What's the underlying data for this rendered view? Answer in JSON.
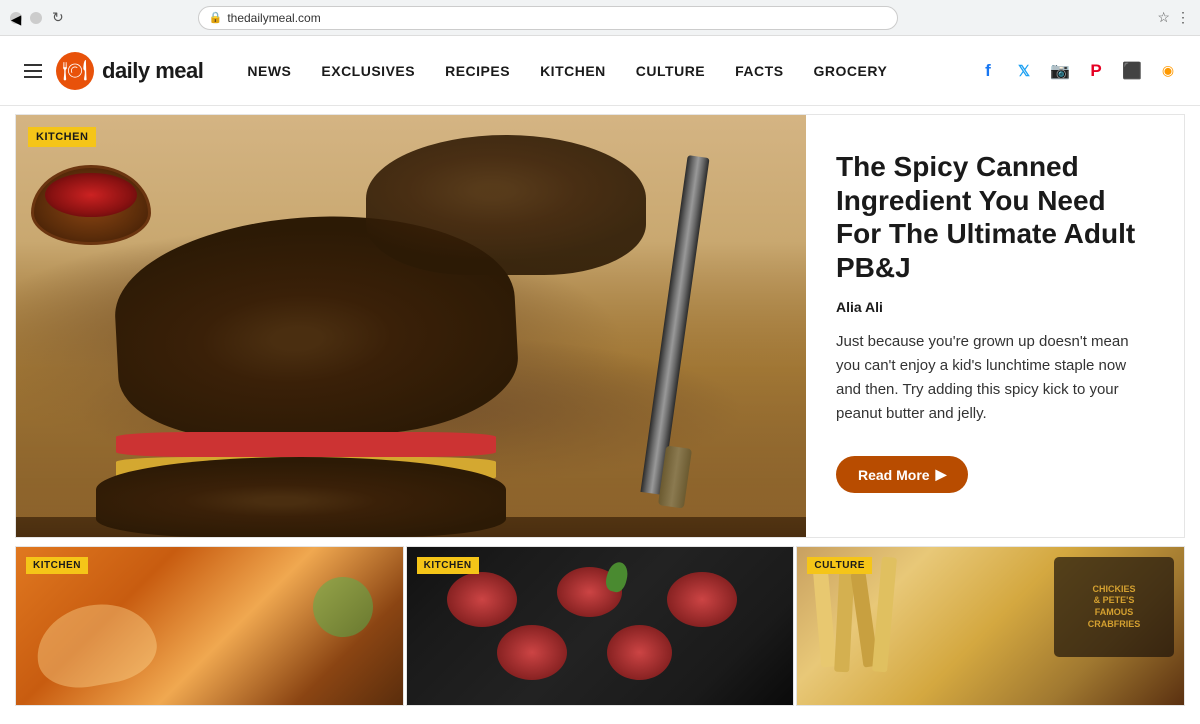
{
  "browser": {
    "url": "thedailymeal.com",
    "back_title": "Back",
    "forward_title": "Forward",
    "refresh_title": "Refresh"
  },
  "nav": {
    "logo_text": "daily meal",
    "hamburger_label": "Menu",
    "links": [
      {
        "label": "NEWS",
        "href": "#"
      },
      {
        "label": "EXCLUSIVES",
        "href": "#"
      },
      {
        "label": "RECIPES",
        "href": "#"
      },
      {
        "label": "KITCHEN",
        "href": "#"
      },
      {
        "label": "CULTURE",
        "href": "#"
      },
      {
        "label": "FACTS",
        "href": "#"
      },
      {
        "label": "GROCERY",
        "href": "#"
      }
    ],
    "social": [
      {
        "name": "facebook",
        "label": "Facebook"
      },
      {
        "name": "twitter",
        "label": "Twitter"
      },
      {
        "name": "instagram",
        "label": "Instagram"
      },
      {
        "name": "pinterest",
        "label": "Pinterest"
      },
      {
        "name": "flipboard",
        "label": "Flipboard"
      },
      {
        "name": "rss",
        "label": "RSS"
      }
    ]
  },
  "featured": {
    "category": "KITCHEN",
    "title": "The Spicy Canned Ingredient You Need For The Ultimate Adult PB&J",
    "author": "Alia Ali",
    "description": "Just because you're grown up doesn't mean you can't enjoy a kid's lunchtime staple now and then. Try adding this spicy kick to your peanut butter and jelly.",
    "read_more_label": "Read More",
    "read_more_arrow": "▶"
  },
  "thumbnails": [
    {
      "category": "KITCHEN",
      "alt": "Tacos on a plate with sauces"
    },
    {
      "category": "KITCHEN",
      "alt": "Ground beef portions on dark background"
    },
    {
      "category": "CULTURE",
      "alt": "Crinkle cut fries with Chickies and Petes branding"
    }
  ]
}
